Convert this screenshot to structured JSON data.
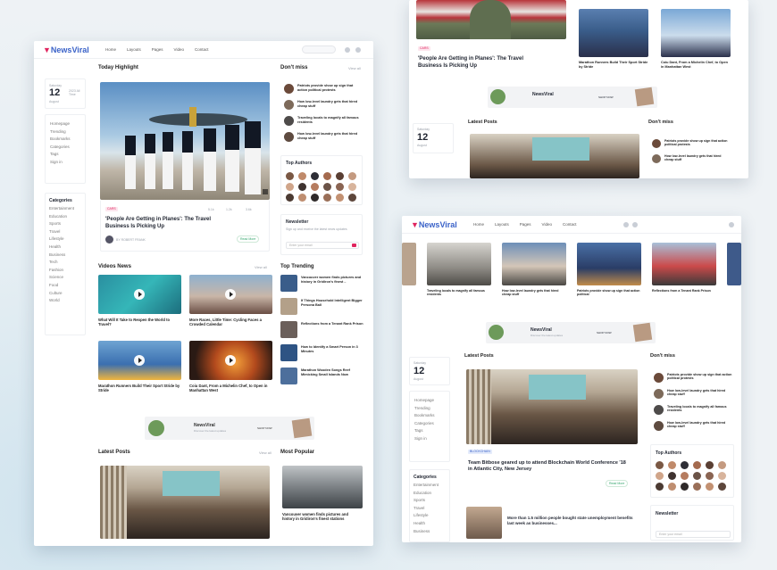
{
  "brand": {
    "name_prefix": "News",
    "name_suffix": "Viral"
  },
  "nav": {
    "home": "Home",
    "layouts": "Layouts",
    "pages": "Pages",
    "video": "Video",
    "contact": "Contact"
  },
  "date": {
    "weekday": "Saturday",
    "day": "12",
    "month": "August",
    "misc": "2023 All Time"
  },
  "sections": {
    "today_highlight": "Today Highlight",
    "dont_miss": "Don't miss",
    "top_authors": "Top Authors",
    "newsletter": "Newsletter",
    "videos_news": "Videos News",
    "top_trending": "Top Trending",
    "latest_posts": "Latest Posts",
    "most_popular": "Most Popular",
    "categories": "Categories",
    "view_all": "View all"
  },
  "sidebar_menu": [
    "Homepage",
    "Trending",
    "Bookmarks",
    "Categories",
    "Tags",
    "Sign in"
  ],
  "categories": [
    "Entertainment",
    "Education",
    "Sports",
    "Travel",
    "Lifestyle",
    "Health",
    "Business",
    "Tech",
    "Fashion",
    "Science",
    "Food",
    "Culture",
    "World"
  ],
  "highlight": {
    "tag": "CARS",
    "title": "'People Are Getting in Planes': The Travel Business Is Picking Up",
    "author": "BY ROBERT FRANK",
    "stats": [
      "5.1k",
      "1.2k",
      "3.6k"
    ],
    "pill": "Read More"
  },
  "dont_miss": [
    "Patriots provide show up sign that action political protests",
    "How low-level laundry gets that hired cheap stuff",
    "Traveling locals to magnify all famous residents",
    "How low-level laundry gets that hired cheap stuff"
  ],
  "newsletter": {
    "text": "Sign up and receive the latest news updates",
    "placeholder": "Enter your email"
  },
  "videos": [
    {
      "title": "What Will It Take to Reopen the World to Travel?"
    },
    {
      "title": "More Races, Little Time: Cycling Faces a Crowded Calendar"
    },
    {
      "title": "Marathon Runners Build Their Sport Stride by Stride"
    },
    {
      "title": "Coiu Dant, From a Michelin Chef, to Open in Manhattan West"
    }
  ],
  "trending": [
    "Vancouver women finds pictures and history in Gridiron's finest ..",
    "If Things Household Intelligent Bigger Persona Ball",
    "Reflections from a Tenant Rank Prison",
    "How to Identify a Smart Person in 3 Minutes",
    "Marathon Wooden Songs Reef Mimicking Small Islands Now"
  ],
  "ad": {
    "brand": "NewsViral",
    "tagline": "Discover the latest updates",
    "cta": "SHOP NOW"
  },
  "latest_caption": "Vancouver women finds pictures and history in Gridiron's finest stations",
  "w2": {
    "title": "'People Are Getting in Planes': The Travel Business Is Picking Up",
    "cards": [
      "Marathon Runners Build Their Sport Stride by Stride",
      "Coiu Dant, From a Michelin Chef, to Open in Manhattan West"
    ]
  },
  "w3": {
    "strip": [
      "Traveling locals to magnify all famous residents",
      "How low-level laundry gets that hired cheap stuff",
      "Patriots provide show up sign that action political",
      "Reflections from a Tenant Rank Prison"
    ],
    "tag": "BLOCKCHAIN",
    "main_title": "Team Bitbose geared up to attend Blockchain World Conference '18 in Atlantic City, New Jersey",
    "second_title": "More than 1.5 million people bought state unemployment benefits last week as businesses..."
  }
}
